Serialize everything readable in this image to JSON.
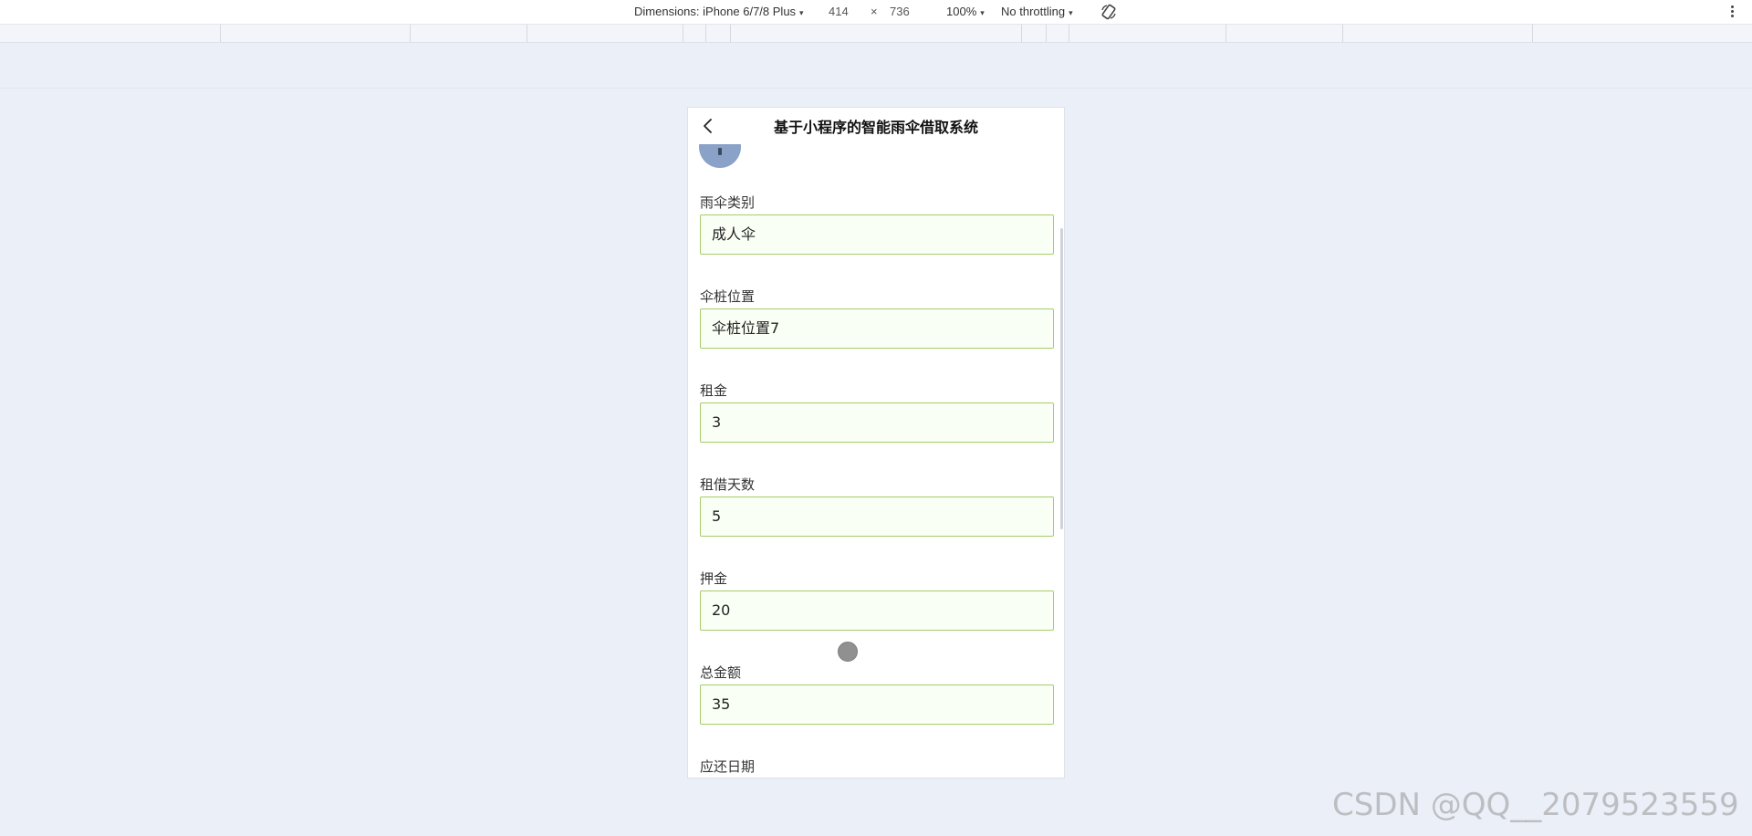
{
  "devtools": {
    "dimensions_label": "Dimensions: iPhone 6/7/8 Plus",
    "width": "414",
    "times": "×",
    "height": "736",
    "zoom": "100%",
    "throttling": "No throttling",
    "caret": "▾"
  },
  "app": {
    "title": "基于小程序的智能雨伞借取系统",
    "fields": [
      {
        "label": "雨伞类别",
        "value": "成人伞"
      },
      {
        "label": "伞桩位置",
        "value": "伞桩位置7"
      },
      {
        "label": "租金",
        "value": "3"
      },
      {
        "label": "租借天数",
        "value": "5"
      },
      {
        "label": "押金",
        "value": "20"
      },
      {
        "label": "总金额",
        "value": "35"
      },
      {
        "label": "应还日期",
        "value": ""
      }
    ]
  },
  "watermark": "CSDN @QQ__2079523559",
  "colors": {
    "input_border": "#a6cc6a",
    "input_background": "#fafff5",
    "page_background": "#ebeff8"
  }
}
